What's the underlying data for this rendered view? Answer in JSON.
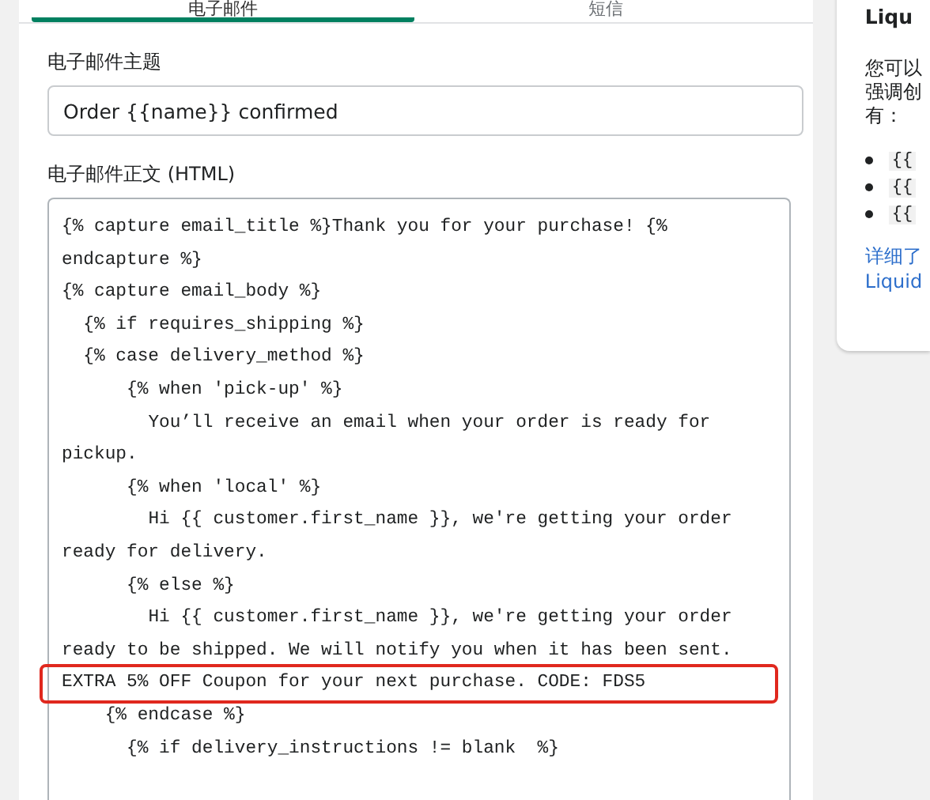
{
  "tabs": [
    {
      "label": "电子邮件",
      "selected": true
    },
    {
      "label": "短信",
      "selected": false
    }
  ],
  "subject": {
    "label": "电子邮件主题",
    "value": "Order {{name}} confirmed"
  },
  "body": {
    "label": "电子邮件正文 (HTML)",
    "lines": [
      {
        "text": "{% capture email_title %}Thank you for your purchase! {% endcapture %}",
        "highlighted": false
      },
      {
        "text": "{% capture email_body %}",
        "highlighted": false
      },
      {
        "text": "  {% if requires_shipping %}",
        "highlighted": false
      },
      {
        "text": "  {% case delivery_method %}",
        "highlighted": false
      },
      {
        "text": "      {% when 'pick-up' %}",
        "highlighted": false
      },
      {
        "text": "        You’ll receive an email when your order is ready for pickup.",
        "highlighted": false
      },
      {
        "text": "      {% when 'local' %}",
        "highlighted": false
      },
      {
        "text": "        Hi {{ customer.first_name }}, we're getting your order ready for delivery.",
        "highlighted": false
      },
      {
        "text": "      {% else %}",
        "highlighted": false
      },
      {
        "text": "        Hi {{ customer.first_name }}, we're getting your order ready to be shipped. We will notify you when it has been sent.",
        "highlighted": false
      },
      {
        "text": "EXTRA 5% OFF Coupon for your next purchase. CODE: FDS5",
        "highlighted": true
      },
      {
        "text": "    {% endcase %}",
        "highlighted": false
      },
      {
        "text": "      {% if delivery_instructions != blank  %}",
        "highlighted": false
      }
    ]
  },
  "side": {
    "title": "Liqu",
    "text_lines": [
      "您可以",
      "强调创",
      "有："
    ],
    "bullets": [
      "{{",
      "{{",
      "{{"
    ],
    "link_lines": [
      "详细了",
      "Liquid"
    ]
  }
}
